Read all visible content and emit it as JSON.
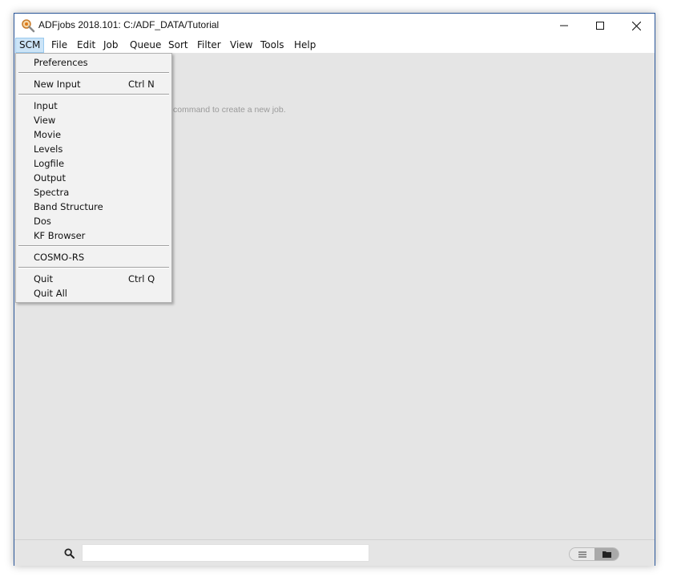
{
  "window": {
    "title": "ADFjobs 2018.101: C:/ADF_DATA/Tutorial",
    "controls": [
      "minimize-icon",
      "maximize-icon",
      "close-icon"
    ]
  },
  "menubar": {
    "items": [
      {
        "label": "SCM",
        "active": true
      },
      {
        "label": "File"
      },
      {
        "label": "Edit"
      },
      {
        "label": "Job"
      },
      {
        "label": "Queue"
      },
      {
        "label": "Sort"
      },
      {
        "label": "Filter"
      },
      {
        "label": "View"
      },
      {
        "label": "Tools"
      },
      {
        "label": "Help"
      }
    ]
  },
  "scm_menu": {
    "items": [
      {
        "label": "Preferences"
      },
      {
        "label": "New Input",
        "shortcut": "Ctrl N"
      },
      {
        "label": "Input"
      },
      {
        "label": "View"
      },
      {
        "label": "Movie"
      },
      {
        "label": "Levels"
      },
      {
        "label": "Logfile"
      },
      {
        "label": "Output"
      },
      {
        "label": "Spectra"
      },
      {
        "label": "Band Structure"
      },
      {
        "label": "Dos"
      },
      {
        "label": "KF Browser"
      },
      {
        "label": "COSMO-RS"
      },
      {
        "label": "Quit",
        "shortcut": "Ctrl Q"
      },
      {
        "label": "Quit All"
      }
    ]
  },
  "main": {
    "hint_visible": "command to create a new job."
  },
  "bottombar": {
    "search_value": "",
    "search_icon": "search-icon",
    "view_toggle": {
      "left_icon": "list-icon",
      "right_icon": "folder-icon",
      "selected": "folder"
    }
  }
}
